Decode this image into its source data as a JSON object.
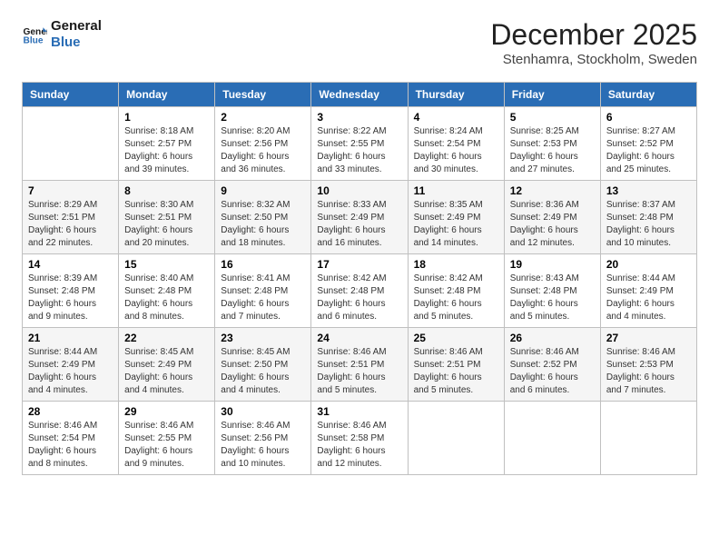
{
  "header": {
    "logo_line1": "General",
    "logo_line2": "Blue",
    "month_title": "December 2025",
    "location": "Stenhamra, Stockholm, Sweden"
  },
  "weekdays": [
    "Sunday",
    "Monday",
    "Tuesday",
    "Wednesday",
    "Thursday",
    "Friday",
    "Saturday"
  ],
  "weeks": [
    [
      {
        "day": "",
        "sunrise": "",
        "sunset": "",
        "daylight": ""
      },
      {
        "day": "1",
        "sunrise": "Sunrise: 8:18 AM",
        "sunset": "Sunset: 2:57 PM",
        "daylight": "Daylight: 6 hours and 39 minutes."
      },
      {
        "day": "2",
        "sunrise": "Sunrise: 8:20 AM",
        "sunset": "Sunset: 2:56 PM",
        "daylight": "Daylight: 6 hours and 36 minutes."
      },
      {
        "day": "3",
        "sunrise": "Sunrise: 8:22 AM",
        "sunset": "Sunset: 2:55 PM",
        "daylight": "Daylight: 6 hours and 33 minutes."
      },
      {
        "day": "4",
        "sunrise": "Sunrise: 8:24 AM",
        "sunset": "Sunset: 2:54 PM",
        "daylight": "Daylight: 6 hours and 30 minutes."
      },
      {
        "day": "5",
        "sunrise": "Sunrise: 8:25 AM",
        "sunset": "Sunset: 2:53 PM",
        "daylight": "Daylight: 6 hours and 27 minutes."
      },
      {
        "day": "6",
        "sunrise": "Sunrise: 8:27 AM",
        "sunset": "Sunset: 2:52 PM",
        "daylight": "Daylight: 6 hours and 25 minutes."
      }
    ],
    [
      {
        "day": "7",
        "sunrise": "Sunrise: 8:29 AM",
        "sunset": "Sunset: 2:51 PM",
        "daylight": "Daylight: 6 hours and 22 minutes."
      },
      {
        "day": "8",
        "sunrise": "Sunrise: 8:30 AM",
        "sunset": "Sunset: 2:51 PM",
        "daylight": "Daylight: 6 hours and 20 minutes."
      },
      {
        "day": "9",
        "sunrise": "Sunrise: 8:32 AM",
        "sunset": "Sunset: 2:50 PM",
        "daylight": "Daylight: 6 hours and 18 minutes."
      },
      {
        "day": "10",
        "sunrise": "Sunrise: 8:33 AM",
        "sunset": "Sunset: 2:49 PM",
        "daylight": "Daylight: 6 hours and 16 minutes."
      },
      {
        "day": "11",
        "sunrise": "Sunrise: 8:35 AM",
        "sunset": "Sunset: 2:49 PM",
        "daylight": "Daylight: 6 hours and 14 minutes."
      },
      {
        "day": "12",
        "sunrise": "Sunrise: 8:36 AM",
        "sunset": "Sunset: 2:49 PM",
        "daylight": "Daylight: 6 hours and 12 minutes."
      },
      {
        "day": "13",
        "sunrise": "Sunrise: 8:37 AM",
        "sunset": "Sunset: 2:48 PM",
        "daylight": "Daylight: 6 hours and 10 minutes."
      }
    ],
    [
      {
        "day": "14",
        "sunrise": "Sunrise: 8:39 AM",
        "sunset": "Sunset: 2:48 PM",
        "daylight": "Daylight: 6 hours and 9 minutes."
      },
      {
        "day": "15",
        "sunrise": "Sunrise: 8:40 AM",
        "sunset": "Sunset: 2:48 PM",
        "daylight": "Daylight: 6 hours and 8 minutes."
      },
      {
        "day": "16",
        "sunrise": "Sunrise: 8:41 AM",
        "sunset": "Sunset: 2:48 PM",
        "daylight": "Daylight: 6 hours and 7 minutes."
      },
      {
        "day": "17",
        "sunrise": "Sunrise: 8:42 AM",
        "sunset": "Sunset: 2:48 PM",
        "daylight": "Daylight: 6 hours and 6 minutes."
      },
      {
        "day": "18",
        "sunrise": "Sunrise: 8:42 AM",
        "sunset": "Sunset: 2:48 PM",
        "daylight": "Daylight: 6 hours and 5 minutes."
      },
      {
        "day": "19",
        "sunrise": "Sunrise: 8:43 AM",
        "sunset": "Sunset: 2:48 PM",
        "daylight": "Daylight: 6 hours and 5 minutes."
      },
      {
        "day": "20",
        "sunrise": "Sunrise: 8:44 AM",
        "sunset": "Sunset: 2:49 PM",
        "daylight": "Daylight: 6 hours and 4 minutes."
      }
    ],
    [
      {
        "day": "21",
        "sunrise": "Sunrise: 8:44 AM",
        "sunset": "Sunset: 2:49 PM",
        "daylight": "Daylight: 6 hours and 4 minutes."
      },
      {
        "day": "22",
        "sunrise": "Sunrise: 8:45 AM",
        "sunset": "Sunset: 2:49 PM",
        "daylight": "Daylight: 6 hours and 4 minutes."
      },
      {
        "day": "23",
        "sunrise": "Sunrise: 8:45 AM",
        "sunset": "Sunset: 2:50 PM",
        "daylight": "Daylight: 6 hours and 4 minutes."
      },
      {
        "day": "24",
        "sunrise": "Sunrise: 8:46 AM",
        "sunset": "Sunset: 2:51 PM",
        "daylight": "Daylight: 6 hours and 5 minutes."
      },
      {
        "day": "25",
        "sunrise": "Sunrise: 8:46 AM",
        "sunset": "Sunset: 2:51 PM",
        "daylight": "Daylight: 6 hours and 5 minutes."
      },
      {
        "day": "26",
        "sunrise": "Sunrise: 8:46 AM",
        "sunset": "Sunset: 2:52 PM",
        "daylight": "Daylight: 6 hours and 6 minutes."
      },
      {
        "day": "27",
        "sunrise": "Sunrise: 8:46 AM",
        "sunset": "Sunset: 2:53 PM",
        "daylight": "Daylight: 6 hours and 7 minutes."
      }
    ],
    [
      {
        "day": "28",
        "sunrise": "Sunrise: 8:46 AM",
        "sunset": "Sunset: 2:54 PM",
        "daylight": "Daylight: 6 hours and 8 minutes."
      },
      {
        "day": "29",
        "sunrise": "Sunrise: 8:46 AM",
        "sunset": "Sunset: 2:55 PM",
        "daylight": "Daylight: 6 hours and 9 minutes."
      },
      {
        "day": "30",
        "sunrise": "Sunrise: 8:46 AM",
        "sunset": "Sunset: 2:56 PM",
        "daylight": "Daylight: 6 hours and 10 minutes."
      },
      {
        "day": "31",
        "sunrise": "Sunrise: 8:46 AM",
        "sunset": "Sunset: 2:58 PM",
        "daylight": "Daylight: 6 hours and 12 minutes."
      },
      {
        "day": "",
        "sunrise": "",
        "sunset": "",
        "daylight": ""
      },
      {
        "day": "",
        "sunrise": "",
        "sunset": "",
        "daylight": ""
      },
      {
        "day": "",
        "sunrise": "",
        "sunset": "",
        "daylight": ""
      }
    ]
  ]
}
